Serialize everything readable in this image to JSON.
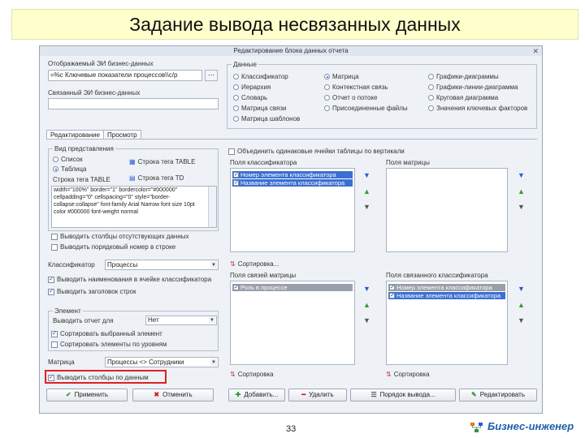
{
  "slide_title": "Задание вывода несвязанных данных",
  "page_number": "33",
  "brand": "Бизнес-инженер",
  "dialog": {
    "title": "Редактирование блока данных отчета",
    "close": "✕",
    "left": {
      "section_label": "Отображаемый ЭИ бизнес-данных",
      "section_value": "=%с Ключевые показатели процессов\\\\с/р",
      "linked_label": "Связанный ЭИ бизнес-данных",
      "linked_value": "",
      "tabs": [
        "Редактирование",
        "Просмотр"
      ],
      "output_group_label": "Вид представления",
      "output_opts": [
        {
          "label": "Список",
          "on": false
        },
        {
          "label": "Таблица",
          "on": true
        }
      ],
      "table_btn_1": "Строка тега TABLE",
      "table_btn_2": "Строка тега TD",
      "row_tag_label": "Строка тега TABLE",
      "html_code": "width=\"100%\" border=\"1\" bordercolor=\"#000000\" cellpadding=\"0\" cellspacing=\"0\" style=\"border-collapse:collapse\" font-family Arial Narrow font size 10pt color #000000 font-weight normal",
      "cb1": "Выводить столбцы отсутствующих данных",
      "cb2": "Выводить порядковый номер в строке",
      "classifier_label": "Классификатор",
      "classifier_value": "Процессы",
      "cb3": "Выводить наименования в ячейке клаcсификатора",
      "cb4": "Выводить заголовок строк",
      "element_group_label": "Элемент",
      "element_field_label": "Выводить отчет для",
      "element_field_value": "Нет",
      "cb5": "Сортировать выбранный элемент",
      "cb6": "Сортировать элементы по уровням",
      "matrix_label": "Матрица",
      "matrix_value": "Процессы <> Сотрудники",
      "cb7": "Выводить столбцы по данным",
      "btn_apply": "Применить",
      "btn_cancel": "Отменить"
    },
    "right": {
      "data_group_label": "Данные",
      "data_types": [
        {
          "label": "Классификатор",
          "on": false
        },
        {
          "label": "Матрица",
          "on": true
        },
        {
          "label": "Графики-диаграммы",
          "on": false
        },
        {
          "label": "Иерархия",
          "on": false
        },
        {
          "label": "Контекстная связь",
          "on": false
        },
        {
          "label": "Графики-линии-диаграмма",
          "on": false
        },
        {
          "label": "Словарь",
          "on": false
        },
        {
          "label": "Отчет о потоке",
          "on": false
        },
        {
          "label": "Круговая диаграмма",
          "on": false
        },
        {
          "label": "Матрица связи",
          "on": false
        },
        {
          "label": "Присоединенные файлы",
          "on": false
        },
        {
          "label": "Значения ключевых факторов",
          "on": false
        },
        {
          "label": "Матрица шаблонов",
          "on": false
        }
      ],
      "merge_cb": "Объединить одинаковые ячейки таблицы по вертикали",
      "class_fields_label": "Поля классификатора",
      "class_fields": [
        {
          "label": "Номер элемента классификатора",
          "checked": true
        },
        {
          "label": "Название элемента классификатора",
          "checked": true
        }
      ],
      "matrix_fields_label": "Поля матрицы",
      "sort_label": "Сортировка...",
      "linked_matrix_label": "Поля связей матрицы",
      "linked_matrix_item": "Роль в процессе",
      "linked_class_label": "Поля связанного классификатора",
      "linked_class_fields": [
        {
          "label": "Номер элемента классификатора",
          "checked": true
        },
        {
          "label": "Название элемента классификатора",
          "checked": true
        }
      ],
      "sort_label_2": "Сортировка",
      "sort_label_3": "Сортировка",
      "btn_add": "Добавить...",
      "btn_delete": "Удалить",
      "btn_order": "Порядок вывода...",
      "btn_edit": "Редактировать"
    }
  }
}
